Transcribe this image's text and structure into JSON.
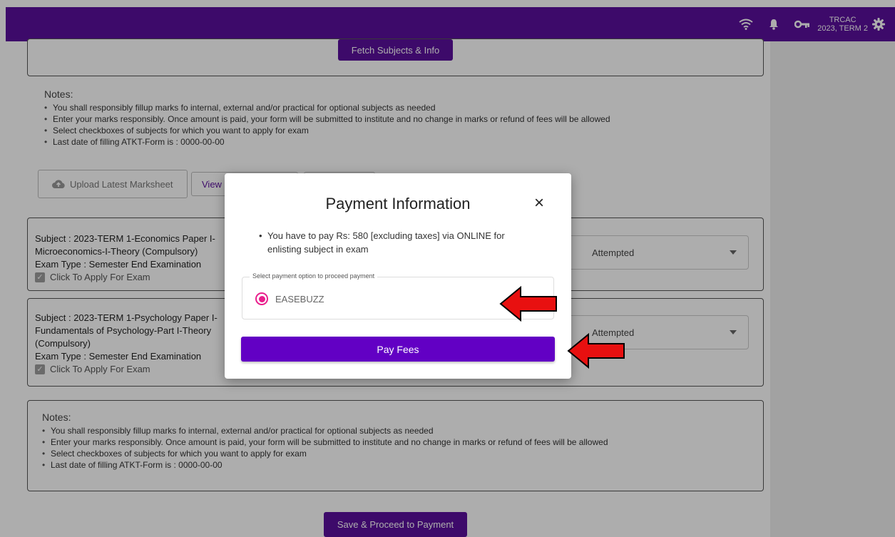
{
  "header": {
    "org_line1": "TRCAC",
    "org_line2": "2023, TERM 2",
    "icons": [
      "wifi-icon",
      "bell-icon",
      "key-icon",
      "gear-icon"
    ],
    "color": "#5a0f9c"
  },
  "top_section": {
    "fetch_button": "Fetch Subjects & Info"
  },
  "notes_top": {
    "title": "Notes:",
    "items": [
      "You shall responsibly fillup marks fo internal, external and/or practical for optional subjects as needed",
      "Enter your marks responsibly. Once amount is paid, your form will be submitted to institute and no change in marks or refund of fees will be allowed",
      "Select checkboxes of subjects for which you want to apply for exam",
      "Last date of filling ATKT-Form is : 0000-00-00"
    ]
  },
  "actions": {
    "upload": "Upload Latest Marksheet",
    "view": "View"
  },
  "subjects": [
    {
      "lines": [
        "Subject : 2023-TERM 1-Economics Paper I-",
        "Microeconomics-I-Theory (Compulsory)",
        "Exam Type : Semester End Examination"
      ],
      "checkbox_label": "Click To Apply For Exam",
      "status": "Attempted"
    },
    {
      "lines": [
        "Subject : 2023-TERM 1-Psychology Paper I-",
        "Fundamentals of Psychology-Part I-Theory",
        "(Compulsory)",
        "Exam Type : Semester End Examination"
      ],
      "checkbox_label": "Click To Apply For Exam",
      "status": "Attempted"
    }
  ],
  "notes_bottom": {
    "title": "Notes:",
    "items": [
      "You shall responsibly fillup marks fo internal, external and/or practical for optional subjects as needed",
      "Enter your marks responsibly. Once amount is paid, your form will be submitted to institute and no change in marks or refund of fees will be allowed",
      "Select checkboxes of subjects for which you want to apply for exam",
      "Last date of filling ATKT-Form is : 0000-00-00"
    ]
  },
  "footer": {
    "save_button": "Save & Proceed to Payment"
  },
  "modal": {
    "title": "Payment Information",
    "close": "×",
    "message": "You have to pay Rs: 580 [excluding taxes] via ONLINE for enlisting subject in exam",
    "legend": "Select payment option to proceed payment",
    "option": "EASEBUZZ",
    "pay_button": "Pay Fees",
    "accent_color": "#6200c4",
    "radio_color": "#e91e8c"
  }
}
